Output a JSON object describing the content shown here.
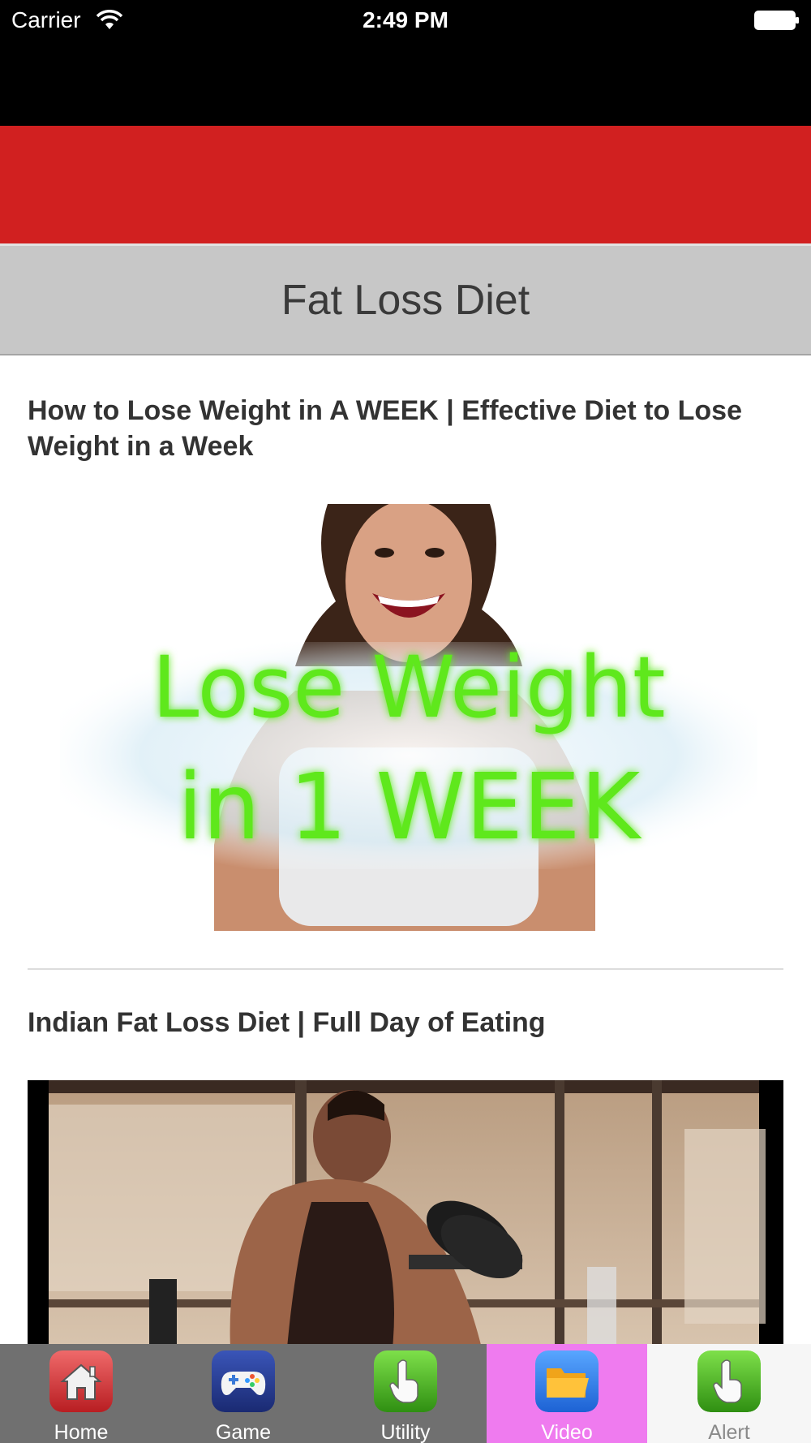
{
  "status_bar": {
    "carrier": "Carrier",
    "time": "2:49 PM"
  },
  "header": {
    "title": "Fat Loss Diet"
  },
  "videos": [
    {
      "title": "How to Lose Weight in A WEEK | Effective Diet to Lose Weight in a Week",
      "thumbnail_text": [
        "Lose Weight",
        "in 1 WEEK"
      ]
    },
    {
      "title": "Indian Fat Loss Diet | Full Day of Eating"
    }
  ],
  "tabs": [
    {
      "label": "Home",
      "icon": "home-icon",
      "selected": false
    },
    {
      "label": "Game",
      "icon": "gamepad-icon",
      "selected": false
    },
    {
      "label": "Utility",
      "icon": "hand-pointer-icon",
      "selected": false
    },
    {
      "label": "Video",
      "icon": "folder-icon",
      "selected": true
    },
    {
      "label": "Alert",
      "icon": "hand-pointer-icon",
      "selected": false
    }
  ],
  "colors": {
    "banner_red": "#d12020",
    "title_bar_gray": "#c7c7c7",
    "tab_bar_gray": "#707070",
    "tab_selected_pink": "#ef7bef",
    "tab_alert_bg": "#f6f6f6",
    "thumbnail_text_green": "#5fe81d"
  }
}
